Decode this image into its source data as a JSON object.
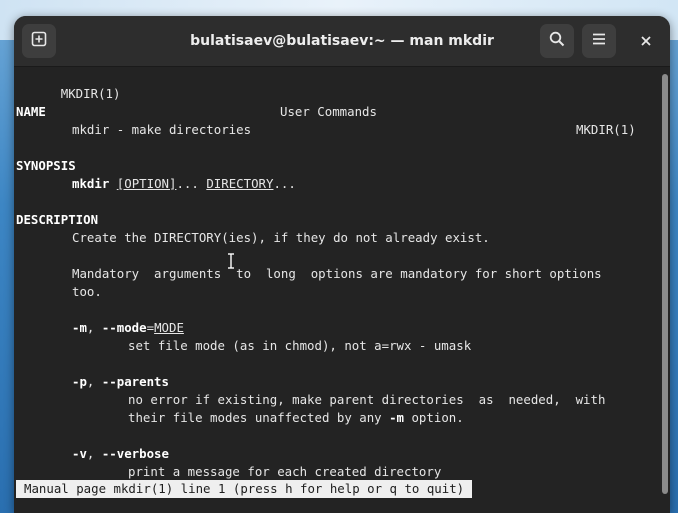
{
  "window": {
    "title": "bulatisaev@bulatisaev:~ — man mkdir"
  },
  "icons": {
    "new_tab": "new-tab-icon",
    "search": "search-icon",
    "menu": "hamburger-menu-icon",
    "close": "close-icon"
  },
  "man": {
    "header_left": "MKDIR(1)",
    "header_center": "User Commands",
    "header_right": "MKDIR(1)",
    "name_heading": "NAME",
    "name_text": "mkdir - make directories",
    "synopsis_heading": "SYNOPSIS",
    "synopsis_cmd": "mkdir",
    "synopsis_option": "[OPTION]",
    "synopsis_ellipsis1": "...",
    "synopsis_directory": "DIRECTORY",
    "synopsis_ellipsis2": "...",
    "description_heading": "DESCRIPTION",
    "desc_line1": "Create the DIRECTORY(ies), if they do not already exist.",
    "desc_line2": "Mandatory  arguments  to  long  options are mandatory for short options",
    "desc_line3": "too.",
    "opt_m_flag": "-m",
    "opt_m_sep": ", ",
    "opt_m_long": "--mode",
    "opt_m_eq": "=",
    "opt_m_arg": "MODE",
    "opt_m_desc": "set file mode (as in chmod), not a=rwx - umask",
    "opt_p_flag": "-p",
    "opt_p_sep": ", ",
    "opt_p_long": "--parents",
    "opt_p_desc1": "no error if existing, make parent directories  as  needed,  with",
    "opt_p_desc2a": "their file modes unaffected by any ",
    "opt_p_desc2b": "-m",
    "opt_p_desc2c": " option.",
    "opt_v_flag": "-v",
    "opt_v_sep": ", ",
    "opt_v_long": "--verbose",
    "opt_v_desc": "print a message for each created directory"
  },
  "status": {
    "text": "Manual page mkdir(1) line 1 (press h for help or q to quit)"
  },
  "colors": {
    "terminal_bg": "#232323",
    "headerbar_bg": "#2d2d2d",
    "status_bg": "#efefef"
  }
}
